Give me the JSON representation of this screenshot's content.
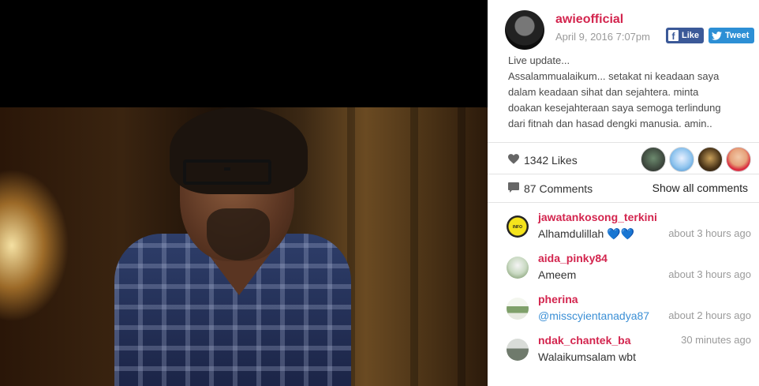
{
  "post": {
    "username": "awieofficial",
    "date": "April 9, 2016 7:07pm",
    "share": {
      "facebook_label": "Like",
      "twitter_label": "Tweet"
    },
    "caption_lines": [
      "Live update...",
      "Assalammualaikum... setakat ni keadaan saya",
      "dalam keadaan sihat dan sejahtera. minta",
      "doakan kesejahteraan saya semoga terlindung",
      "dari fitnah dan hasad dengki manusia. amin.."
    ],
    "likes_label": "1342 Likes",
    "comments_label": "87 Comments",
    "show_all_label": "Show all comments"
  },
  "comments": [
    {
      "user": "jawatankosong_terkini",
      "text": "Alhamdulillah",
      "emoji": "💙💙",
      "time": "about 3 hours ago",
      "avatar_color": "#f2e21c"
    },
    {
      "user": "aida_pinky84",
      "text": "Ameem",
      "time": "about 3 hours ago",
      "avatar_color": "#c8d8c0"
    },
    {
      "user": "pherina",
      "text": "@misscyientanadya87",
      "time": "about 2 hours ago",
      "avatar_color": "#d5e2c7"
    },
    {
      "user": "ndak_chantek_ba",
      "text": "Walaikumsalam wbt",
      "time": "30 minutes ago",
      "avatar_color": "#9aa39a"
    }
  ],
  "colors": {
    "accent": "#d3254e",
    "facebook": "#3b5998",
    "twitter": "#2d8fd5",
    "mention": "#3b8fd5"
  }
}
